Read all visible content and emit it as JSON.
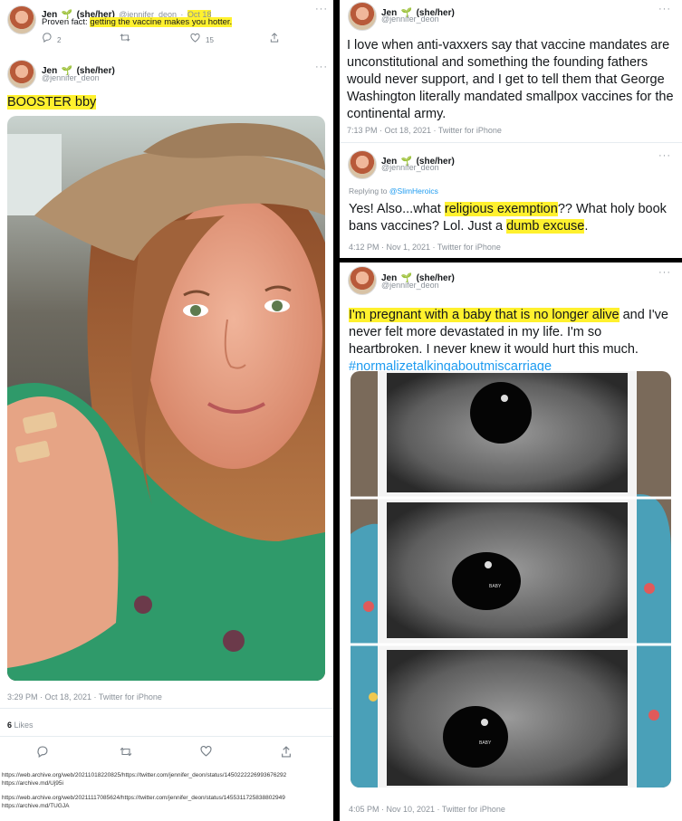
{
  "left": {
    "tweet1": {
      "name": "Jen",
      "pronouns": "(she/her)",
      "handle": "@jennifer_deon",
      "sep": "·",
      "date": "Oct 18",
      "text_plain": "Proven fact: ",
      "text_highlight": "getting the vaccine makes you hotter.",
      "replies": "2",
      "likes": "15",
      "more": "···"
    },
    "tweet2": {
      "name": "Jen",
      "pronouns": "(she/her)",
      "handle": "@jennifer_deon",
      "text_highlight": "BOOSTER bby",
      "timestamp": "3:29 PM · Oct 18, 2021 · Twitter for iPhone",
      "likes_count": "6",
      "likes_label": "Likes",
      "more": "···"
    },
    "archive": {
      "line1": "https://web.archive.org/web/20211018220825/https://twitter.com/jennifer_deon/status/1450222226993676292",
      "line2": "https://archive.md/Uj95i",
      "line3": "https://web.archive.org/web/20211117085624/https://twitter.com/jennifer_deon/status/1455311725838802949",
      "line4": "https://archive.md/TUGJA"
    }
  },
  "right": {
    "tweet3": {
      "name": "Jen",
      "pronouns": "(she/her)",
      "handle": "@jennifer_deon",
      "text": "I love when anti-vaxxers say that vaccine mandates are unconstitutional and something the founding fathers would never support, and I get to tell them that George Washington literally mandated smallpox vaccines for the continental army.",
      "timestamp": "7:13 PM · Oct 18, 2021 · Twitter for iPhone",
      "more": "···"
    },
    "tweet4": {
      "name": "Jen",
      "pronouns": "(she/her)",
      "handle": "@jennifer_deon",
      "replying_prefix": "Replying to ",
      "replying_handle": "@SlimHeroics",
      "text_a": "Yes! Also...what ",
      "text_hl1": "religious exemption",
      "text_b": "?? What holy book bans vaccines? Lol. Just a ",
      "text_hl2": "dumb excuse",
      "text_c": ".",
      "timestamp": "4:12 PM · Nov 1, 2021 · Twitter for iPhone",
      "more": "···"
    },
    "tweet5": {
      "name": "Jen",
      "pronouns": "(she/her)",
      "handle": "@jennifer_deon",
      "text_hl": "I'm pregnant with a baby that is no longer alive",
      "text_rest": " and I've never felt more devastated in my life. I'm so heartbroken. I never knew it would hurt this much.",
      "hashtag": "#normalizetalkingaboutmiscarriage",
      "timestamp": "4:05 PM · Nov 10, 2021 · Twitter for iPhone",
      "ultrasound_label": "BABY",
      "more": "···"
    }
  },
  "icons": {
    "reply": "reply-icon",
    "retweet": "retweet-icon",
    "like": "heart-icon",
    "share": "share-icon",
    "sprout": "sprout-icon"
  }
}
